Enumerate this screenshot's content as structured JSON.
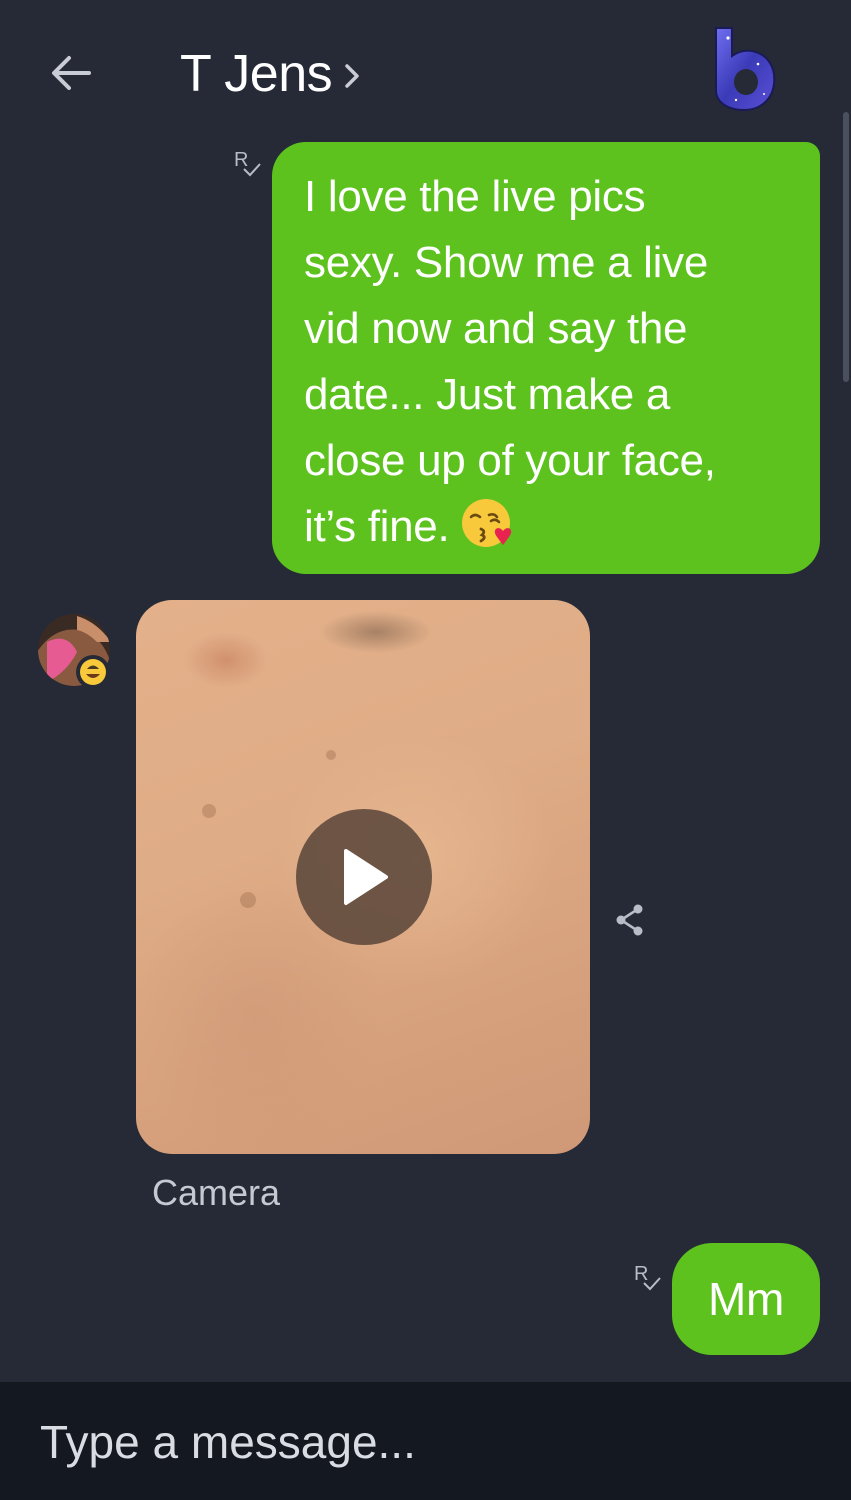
{
  "header": {
    "title": "T Jens",
    "back_icon": "arrow-left-icon",
    "chevron_icon": "chevron-right-icon",
    "app_logo_icon": "b-logo-icon"
  },
  "colors": {
    "background": "#252a36",
    "outgoing_bubble": "#5dc21e",
    "composer_background": "#141821",
    "text": "#ffffff"
  },
  "messages": [
    {
      "direction": "outgoing",
      "receipt": "R",
      "lines": [
        "I love the live pics",
        "sexy. Show me a live",
        "vid now and say the",
        "date... Just make a",
        "close up of your face,",
        "it’s fine."
      ],
      "emoji": "face-blowing-a-kiss-icon"
    },
    {
      "direction": "incoming",
      "type": "video",
      "caption": "Camera",
      "play_icon": "play-icon",
      "share_icon": "share-icon"
    },
    {
      "direction": "outgoing",
      "receipt": "R",
      "text": "Mm"
    }
  ],
  "composer": {
    "placeholder": "Type a message..."
  }
}
